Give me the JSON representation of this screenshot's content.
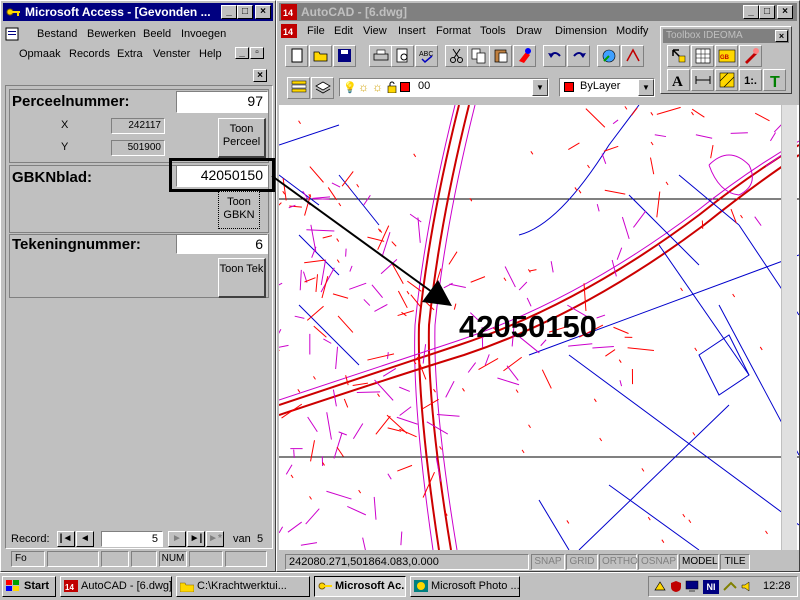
{
  "access": {
    "title": "Microsoft Access - [Gevonden ...",
    "menu_row1": [
      "Bestand",
      "Bewerken",
      "Beeld",
      "Invoegen"
    ],
    "menu_row2": [
      "Opmaak",
      "Records",
      "Extra",
      "Venster",
      "Help"
    ],
    "form": {
      "perceel_label": "Perceelnummer:",
      "perceel_value": "97",
      "x_label": "X",
      "x_value": "242117",
      "y_label": "Y",
      "y_value": "501900",
      "toon_perceel": "Toon Perceel",
      "gbkn_label": "GBKNblad:",
      "gbkn_value": "42050150",
      "toon_gbkn": "Toon GBKN",
      "tek_label": "Tekeningnummer:",
      "tek_value": "6",
      "toon_tek": "Toon Tek"
    },
    "record_nav": {
      "label": "Record:",
      "current": "5",
      "of_label": "van",
      "total": "5"
    },
    "status": {
      "left": "Fo",
      "num": "NUM"
    }
  },
  "autocad": {
    "title": "AutoCAD - [6.dwg]",
    "menus": [
      "File",
      "Edit",
      "View",
      "Insert",
      "Format",
      "Tools",
      "Draw",
      "Dimension",
      "Modify"
    ],
    "layer_name": "00",
    "linetype": "ByLayer",
    "annotation": "42050150",
    "coords": "242080.271,501864.083,0.000",
    "status_toggles": [
      {
        "label": "SNAP",
        "on": false
      },
      {
        "label": "GRID",
        "on": false
      },
      {
        "label": "ORTHO",
        "on": false
      },
      {
        "label": "OSNAP",
        "on": false
      },
      {
        "label": "MODEL",
        "on": true
      },
      {
        "label": "TILE",
        "on": true
      }
    ],
    "toolbox_title": "Toolbox IDEOMA",
    "toolbox_text_btn": "1:."
  },
  "taskbar": {
    "start": "Start",
    "items": [
      {
        "label": "AutoCAD - [6.dwg]",
        "pressed": false
      },
      {
        "label": "C:\\Krachtwerktui...",
        "pressed": false
      },
      {
        "label": "Microsoft Ac...",
        "pressed": true
      },
      {
        "label": "Microsoft Photo ...",
        "pressed": false
      }
    ],
    "tray_ni": "NI",
    "clock": "12:28"
  },
  "colors": {
    "titlebar_active": "#000080",
    "titlebar_inactive": "#808080",
    "map_red": "#ff0000",
    "map_magenta": "#cc00cc",
    "map_blue": "#0000cc"
  }
}
